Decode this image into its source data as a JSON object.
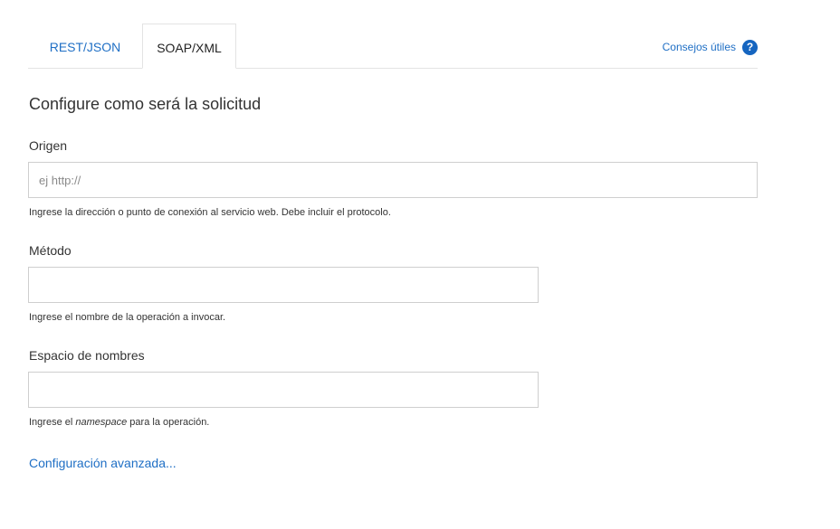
{
  "tabs": [
    {
      "label": "REST/JSON",
      "active": false
    },
    {
      "label": "SOAP/XML",
      "active": true
    }
  ],
  "help": {
    "label": "Consejos útiles",
    "icon": "help-icon",
    "icon_glyph": "?"
  },
  "section_title": "Configure como será la solicitud",
  "fields": {
    "origin": {
      "label": "Origen",
      "value": "",
      "placeholder": "ej http://",
      "hint": "Ingrese la dirección o punto de conexión al servicio web. Debe incluir el protocolo."
    },
    "method": {
      "label": "Método",
      "value": "",
      "hint": "Ingrese el nombre de la operación a invocar."
    },
    "namespace": {
      "label": "Espacio de nombres",
      "value": "",
      "hint_prefix": "Ingrese el ",
      "hint_emphasis": "namespace",
      "hint_suffix": " para la operación."
    }
  },
  "advanced_link": "Configuración avanzada...",
  "colors": {
    "accent": "#1f6fc5",
    "help_icon_bg": "#1565c0",
    "border": "#cfcfcf"
  }
}
